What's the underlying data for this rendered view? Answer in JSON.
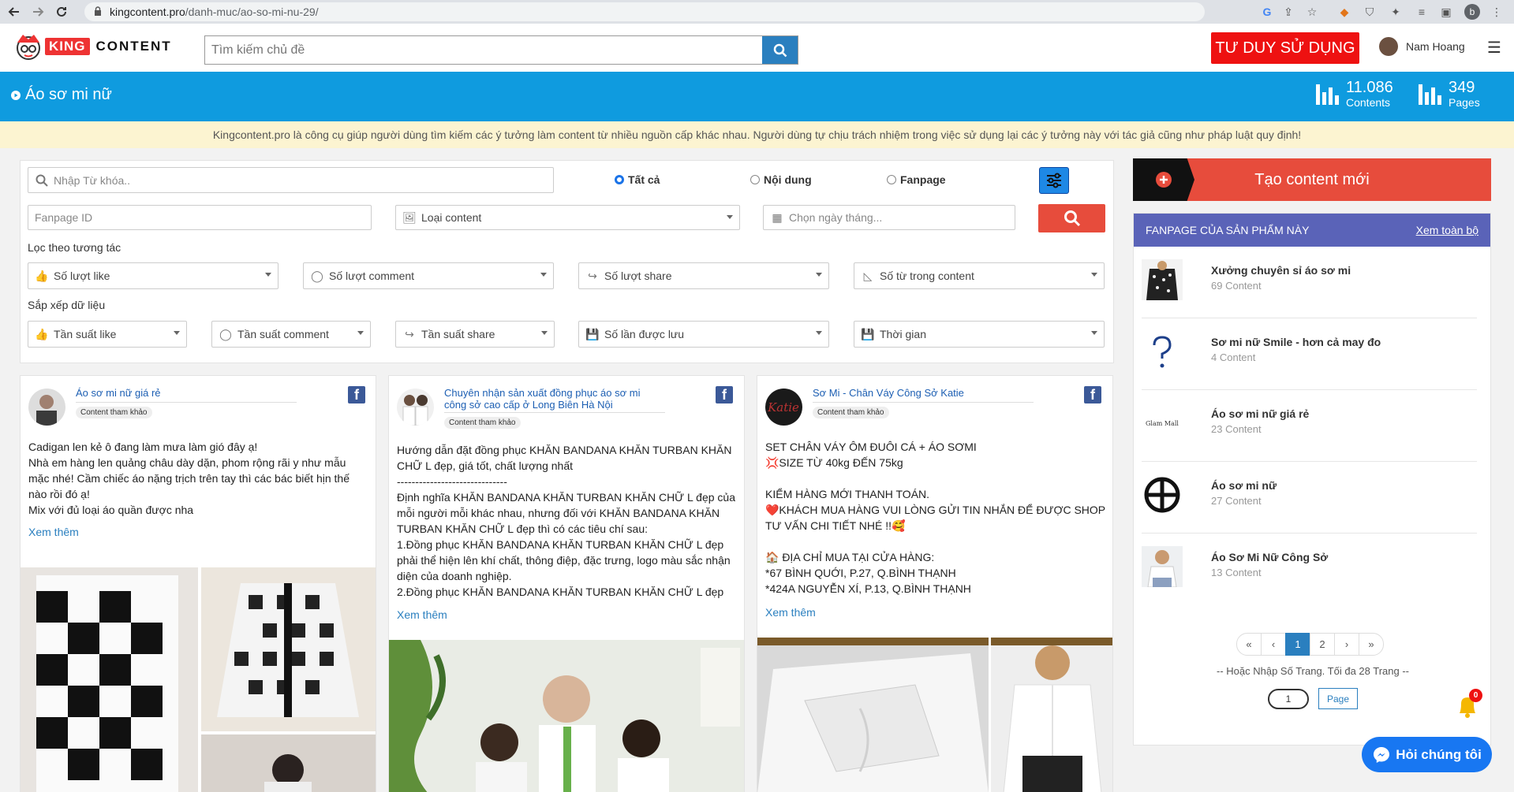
{
  "browser": {
    "url_domain": "kingcontent.pro",
    "url_path": "/danh-muc/ao-so-mi-nu-29/",
    "profile_initial": "b"
  },
  "header": {
    "logo_king": "KING",
    "logo_content": "CONTENT",
    "search_placeholder": "Tìm kiếm chủ đề",
    "cta_label": "TƯ DUY SỬ DỤNG",
    "user_name": "Nam Hoang"
  },
  "category_bar": {
    "title": "Áo sơ mi nữ",
    "contents_count": "11.086",
    "contents_label": "Contents",
    "pages_count": "349",
    "pages_label": "Pages",
    "color": "#0f9bdf"
  },
  "notice": "Kingcontent.pro là công cụ giúp người dùng tìm kiếm các ý tưởng làm content từ nhiều nguồn cấp khác nhau. Người dùng tự chịu trách nhiệm trong việc sử dụng lại các ý tưởng này với tác giả cũng như pháp luật quy định!",
  "filter": {
    "keyword_placeholder": "Nhập Từ khóa..",
    "radio_all": "Tất cả",
    "radio_content": "Nội dung",
    "radio_fanpage": "Fanpage",
    "selected_radio": "Tất cả",
    "fanpage_id_placeholder": "Fanpage ID",
    "content_type": "Loại content",
    "date_placeholder": "Chọn ngày tháng...",
    "interaction_label": "Lọc theo tương tác",
    "likes": "Số lượt like",
    "comments": "Số lượt comment",
    "shares": "Số lượt share",
    "words": "Số từ trong content",
    "sort_label": "Sắp xếp dữ liệu",
    "freq_like": "Tần suất like",
    "freq_comment": "Tần suất comment",
    "freq_share": "Tần suất share",
    "saved": "Số lần được lưu",
    "time": "Thời gian"
  },
  "cards": [
    {
      "name": "Áo sơ mi nữ giá rẻ",
      "tag": "Content tham khảo",
      "body": "Cadigan len kẻ ô đang làm mưa làm gió đây ạ!\nNhà em hàng len quảng châu dày dặn, phom rộng rãi y như mẫu mặc nhé! Cầm chiếc áo nặng trịch trên tay thì các bác biết hịn thế nào rồi đó ạ!\nMix với đủ loại áo quần được nha",
      "more": "Xem thêm"
    },
    {
      "name": "Chuyên nhận sản xuất đồng phục áo sơ mi công sở cao cấp ở Long Biên Hà Nội",
      "tag": "Content tham khảo",
      "body": "Hướng dẫn đặt đồng phục KHĂN BANDANA KHĂN TURBAN KHĂN CHỮ L đẹp, giá tốt, chất lượng nhất\n------------------------------\nĐịnh nghĩa KHĂN BANDANA KHĂN TURBAN KHĂN CHỮ L đẹp của mỗi người mỗi khác nhau, nhưng đối với KHĂN BANDANA KHĂN TURBAN KHĂN CHỮ L đẹp thì có các tiêu chí sau:\n1.Đồng phục KHĂN BANDANA KHĂN TURBAN KHĂN CHỮ L đẹp phải thể hiện lên khí chất, thông điệp, đặc trưng, logo màu sắc nhận diện của doanh nghiệp.\n2.Đồng phục KHĂN BANDANA KHĂN TURBAN KHĂN CHỮ L đẹp",
      "more": "Xem thêm"
    },
    {
      "name": "Sơ Mi - Chân Váy Công Sở Katie",
      "tag": "Content tham khảo",
      "body": "SET CHÂN VÁY ÔM ĐUÔI CÁ + ÁO SƠMI\n💢SIZE TỪ 40kg ĐẾN 75kg\n\nKIỂM HÀNG MỚI THANH TOÁN.\n❤️KHÁCH MUA HÀNG VUI LÒNG GỬI TIN NHẮN ĐỂ ĐƯỢC SHOP TƯ VẤN CHI TIẾT NHÉ !!🥰\n\n🏠 ĐỊA CHỈ MUA TẠI CỬA HÀNG:\n*67 BÌNH QUỚI, P.27, Q.BÌNH THẠNH\n*424A NGUYỄN XÍ, P.13, Q.BÌNH THẠNH",
      "more": "Xem thêm"
    }
  ],
  "sidebar": {
    "create_label": "Tạo content mới",
    "create_color": "#e74c3c",
    "header": "FANPAGE CỦA SẢN PHẨM NÀY",
    "view_all": "Xem toàn bộ",
    "fanpages": [
      {
        "name": "Xưởng chuyên sỉ áo sơ mi",
        "count": "69 Content"
      },
      {
        "name": "Sơ mi nữ Smile - hơn cả may đo",
        "count": "4 Content"
      },
      {
        "name": "Áo sơ mi nữ giá rẻ",
        "count": "23 Content"
      },
      {
        "name": "Áo sơ mi nữ",
        "count": "27 Content"
      },
      {
        "name": "Áo Sơ Mi Nữ Công Sở",
        "count": "13 Content"
      }
    ],
    "pager": {
      "first": "«",
      "prev": "‹",
      "p1": "1",
      "p2": "2",
      "next": "›",
      "last": "»"
    },
    "pager_note": "-- Hoặc Nhập Số Trang. Tối đa 28 Trang --",
    "page_input": "1",
    "page_button": "Page"
  },
  "thumb_glam": "Glam Mall",
  "bell_count": "0",
  "chat_label": "Hỏi chúng tôi"
}
